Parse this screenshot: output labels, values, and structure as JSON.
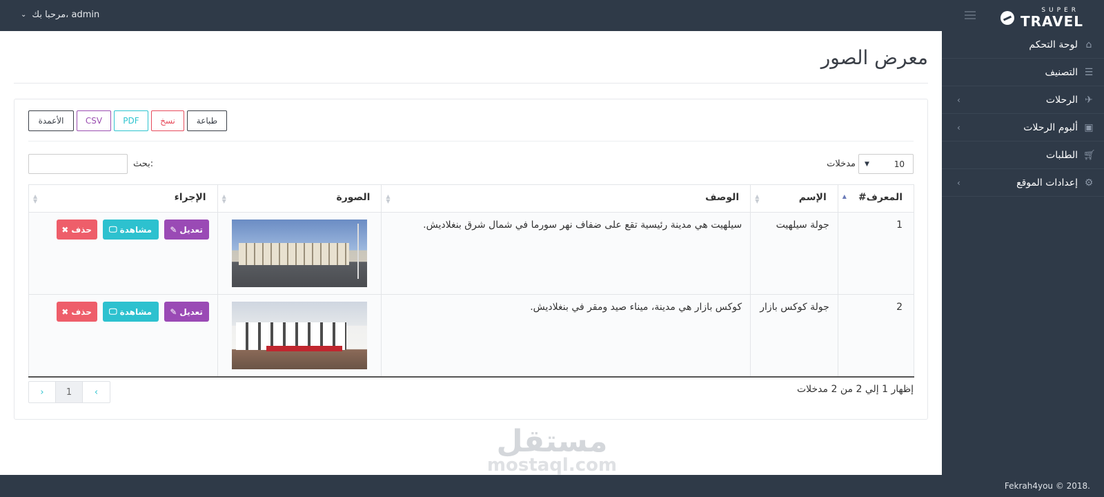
{
  "brand": {
    "super": "SUPER",
    "travel": "TRAVEL"
  },
  "user": {
    "greeting": "مرحبا بك، admin"
  },
  "sidebar": {
    "items": [
      {
        "label": "لوحة التحكم",
        "icon": "home-icon",
        "has_arrow": false
      },
      {
        "label": "التصنيف",
        "icon": "list-icon",
        "has_arrow": false
      },
      {
        "label": "الرحلات",
        "icon": "plane-icon",
        "has_arrow": true
      },
      {
        "label": "ألبوم الرحلات",
        "icon": "image-icon",
        "has_arrow": true
      },
      {
        "label": "الطلبات",
        "icon": "cart-icon",
        "has_arrow": false
      },
      {
        "label": "إعدادات الموقع",
        "icon": "gears-icon",
        "has_arrow": true
      }
    ]
  },
  "page": {
    "title": "معرض الصور"
  },
  "toolbar": {
    "columns": "الأعمدة",
    "csv": "CSV",
    "pdf": "PDF",
    "copy": "نسخ",
    "print": "طباعة"
  },
  "search": {
    "label": "بحث:",
    "value": ""
  },
  "length": {
    "value": "10",
    "label": "مدخلات"
  },
  "table": {
    "headers": {
      "id": "المعرف#",
      "name": "الإسم",
      "desc": "الوصف",
      "image": "الصورة",
      "action": "الإجراء"
    },
    "rows": [
      {
        "id": "1",
        "name": "جولة سيلهيت",
        "desc": "سيلهيت هي مدينة رئيسية تقع على ضفاف نهر سورما في شمال شرق بنغلاديش."
      },
      {
        "id": "2",
        "name": "جولة كوكس بازار",
        "desc": "كوكس بازار هي مدينة، ميناء صيد ومقر في بنغلاديش."
      }
    ],
    "actions": {
      "edit": "تعديل",
      "view": "مشاهدة",
      "delete": "حذف"
    }
  },
  "info": "إظهار 1 إلي 2 من 2 مدخلات",
  "pagination": {
    "prev": "‹",
    "page": "1",
    "next": "›"
  },
  "watermark": {
    "ar": "مستقل",
    "en": "mostaql.com"
  },
  "footer": {
    "copyright": "Fekrah4you © 2018."
  },
  "colors": {
    "header_bg": "#2f3a48",
    "edit": "#9a4ab5",
    "view": "#2dc1cf",
    "delete": "#ee5e6a"
  }
}
